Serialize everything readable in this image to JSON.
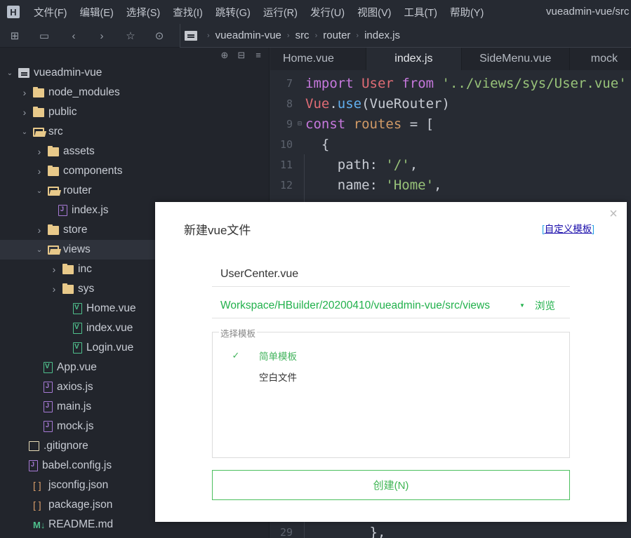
{
  "menubar": {
    "logo": "H",
    "items": [
      "文件(F)",
      "编辑(E)",
      "选择(S)",
      "查找(I)",
      "跳转(G)",
      "运行(R)",
      "发行(U)",
      "视图(V)",
      "工具(T)",
      "帮助(Y)"
    ],
    "window_title": "vueadmin-vue/src"
  },
  "toolbar": {
    "icons": [
      "new-file-icon",
      "save-icon",
      "back-icon",
      "forward-icon",
      "star-icon",
      "run-icon"
    ],
    "breadcrumb": [
      "vueadmin-vue",
      "src",
      "router",
      "index.js"
    ]
  },
  "sidebar": {
    "tools": [
      "locate-icon",
      "collapse-icon",
      "menu-icon"
    ],
    "tree": [
      {
        "label": "vueadmin-vue",
        "depth": 0,
        "type": "project",
        "expanded": true
      },
      {
        "label": "node_modules",
        "depth": 1,
        "type": "folder",
        "expanded": false
      },
      {
        "label": "public",
        "depth": 1,
        "type": "folder",
        "expanded": false
      },
      {
        "label": "src",
        "depth": 1,
        "type": "folder",
        "expanded": true
      },
      {
        "label": "assets",
        "depth": 2,
        "type": "folder",
        "expanded": false
      },
      {
        "label": "components",
        "depth": 2,
        "type": "folder",
        "expanded": false
      },
      {
        "label": "router",
        "depth": 2,
        "type": "folder",
        "expanded": true
      },
      {
        "label": "index.js",
        "depth": 3,
        "type": "js"
      },
      {
        "label": "store",
        "depth": 2,
        "type": "folder",
        "expanded": false
      },
      {
        "label": "views",
        "depth": 2,
        "type": "folder",
        "expanded": true,
        "selected": true
      },
      {
        "label": "inc",
        "depth": 3,
        "type": "folder",
        "expanded": false
      },
      {
        "label": "sys",
        "depth": 3,
        "type": "folder",
        "expanded": false
      },
      {
        "label": "Home.vue",
        "depth": 4,
        "type": "vue"
      },
      {
        "label": "index.vue",
        "depth": 4,
        "type": "vue"
      },
      {
        "label": "Login.vue",
        "depth": 4,
        "type": "vue"
      },
      {
        "label": "App.vue",
        "depth": 2,
        "type": "vue"
      },
      {
        "label": "axios.js",
        "depth": 2,
        "type": "js"
      },
      {
        "label": "main.js",
        "depth": 2,
        "type": "js"
      },
      {
        "label": "mock.js",
        "depth": 2,
        "type": "js"
      },
      {
        "label": ".gitignore",
        "depth": 1,
        "type": "plain"
      },
      {
        "label": "babel.config.js",
        "depth": 1,
        "type": "js"
      },
      {
        "label": "jsconfig.json",
        "depth": 1,
        "type": "json"
      },
      {
        "label": "package.json",
        "depth": 1,
        "type": "json"
      },
      {
        "label": "README.md",
        "depth": 1,
        "type": "md"
      }
    ]
  },
  "editor": {
    "tabs": [
      {
        "label": "Home.vue",
        "active": false
      },
      {
        "label": "index.js",
        "active": true
      },
      {
        "label": "SideMenu.vue",
        "active": false
      },
      {
        "label": "mock",
        "active": false
      }
    ],
    "lines": [
      {
        "n": "7",
        "tokens": [
          [
            "kw",
            "import"
          ],
          [
            "code",
            " "
          ],
          [
            "var",
            "User"
          ],
          [
            "code",
            " "
          ],
          [
            "kw",
            "from"
          ],
          [
            "code",
            " "
          ],
          [
            "str",
            "'../views/sys/User.vue'"
          ]
        ]
      },
      {
        "n": "8",
        "tokens": [
          [
            "var",
            "Vue"
          ],
          [
            "code",
            "."
          ],
          [
            "fn",
            "use"
          ],
          [
            "code",
            "(VueRouter)"
          ]
        ]
      },
      {
        "n": "9",
        "fold": true,
        "tokens": [
          [
            "kw",
            "const"
          ],
          [
            "code",
            " "
          ],
          [
            "cst",
            "routes"
          ],
          [
            "code",
            " = ["
          ]
        ]
      },
      {
        "n": "10",
        "tokens": [
          [
            "code",
            "  {"
          ]
        ]
      },
      {
        "n": "11",
        "tokens": [
          [
            "prop",
            "    path"
          ],
          [
            "code",
            ": "
          ],
          [
            "str",
            "'/'"
          ],
          [
            "code",
            ","
          ]
        ]
      },
      {
        "n": "12",
        "tokens": [
          [
            "prop",
            "    name"
          ],
          [
            "code",
            ": "
          ],
          [
            "str",
            "'Home'"
          ],
          [
            "code",
            ","
          ]
        ]
      }
    ],
    "bottom_line": {
      "n": "29",
      "text": "        },"
    }
  },
  "dialog": {
    "title": "新建vue文件",
    "custom_template_link": "自定义模板",
    "filename_value": "UserCenter.vue",
    "path_value": "Workspace/HBuilder/20200410/vueadmin-vue/src/views",
    "browse_label": "浏览",
    "template_group_label": "选择模板",
    "templates": [
      {
        "label": "简单模板",
        "selected": true
      },
      {
        "label": "空白文件",
        "selected": false
      }
    ],
    "create_label": "创建(N)"
  }
}
